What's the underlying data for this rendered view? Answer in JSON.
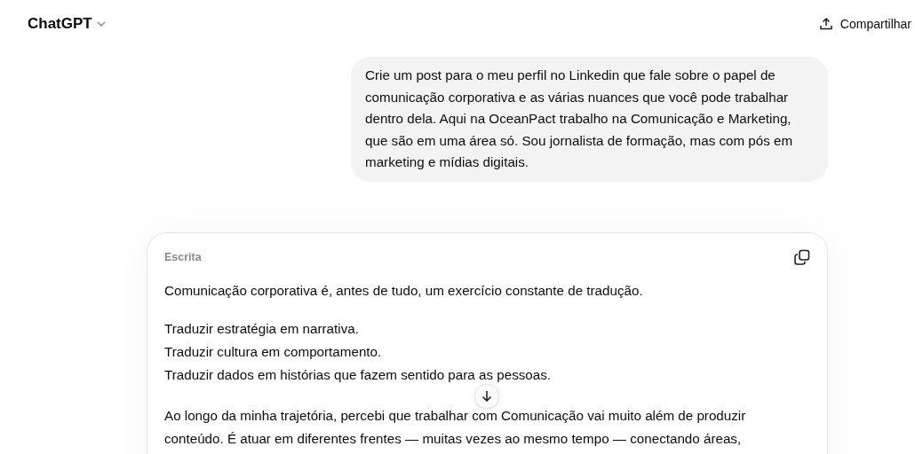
{
  "header": {
    "model": "ChatGPT",
    "share": "Compartilhar"
  },
  "user_message": "Crie um post para o meu perfil no Linkedin que fale sobre o papel de comunicação corporativa e as várias nuances que você pode trabalhar dentro dela. Aqui na OceanPact trabalho na Comunicação e Marketing, que são em uma área só. Sou jornalista de formação, mas com pós em marketing e mídias digitais.",
  "canvas": {
    "label": "Escrita",
    "paragraphs": [
      {
        "lines": [
          "Comunicação corporativa é, antes de tudo, um exercício constante de tradução."
        ]
      },
      {
        "lines": [
          "Traduzir estratégia em narrativa.",
          "Traduzir cultura em comportamento.",
          "Traduzir dados em histórias que fazem sentido para as pessoas."
        ]
      },
      {
        "lines": [
          "Ao longo da minha trajetória, percebi que trabalhar com Comunicação vai muito além de produzir",
          "conteúdo. É atuar em diferentes frentes — muitas vezes ao mesmo tempo — conectando áreas,"
        ]
      }
    ]
  }
}
